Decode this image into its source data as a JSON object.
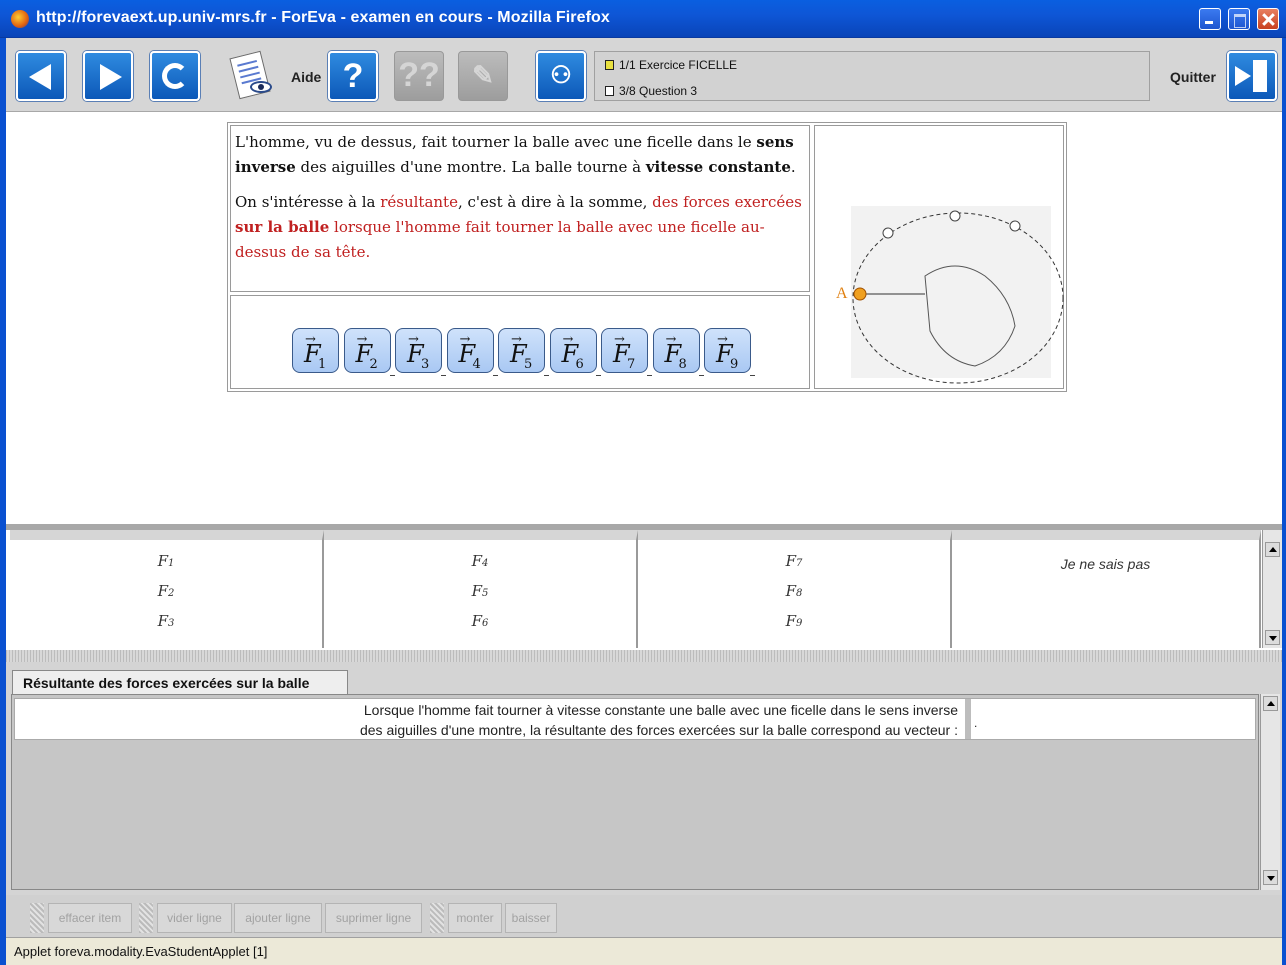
{
  "window": {
    "title": "http://forevaext.up.univ-mrs.fr - ForEva - examen en cours - Mozilla Firefox"
  },
  "toolbar": {
    "aide_label": "Aide",
    "quit_label": "Quitter",
    "exercise_line": "1/1  Exercice FICELLE",
    "question_line": "3/8  Question 3",
    "icons": [
      "back-arrow-icon",
      "forward-arrow-icon",
      "refresh-icon",
      "document-view-icon",
      "help-icon",
      "help-disabled-icon",
      "eraser-disabled-icon",
      "tree-icon",
      "exit-door-icon"
    ]
  },
  "question": {
    "para1_a": "L'homme, vu de dessus, fait tourner la balle avec une ficelle dans le ",
    "para1_b": "sens inverse",
    "para1_c": " des aiguilles d'une montre. La balle tourne à ",
    "para1_d": "vitesse constante",
    "para1_e": ".",
    "para2_a": "On s'intéresse à la ",
    "para2_b": "résultante",
    "para2_c": ", c'est à dire à la somme, ",
    "para2_d": "des forces exercées ",
    "para2_e": "sur la balle",
    "para2_f": " lorsque l'homme fait tourner la balle avec une ficelle au-dessus de sa tête.",
    "figure_label": "A",
    "red_color": "#c02020"
  },
  "force_buttons": [
    {
      "label": "F",
      "sub": "1"
    },
    {
      "label": "F",
      "sub": "2"
    },
    {
      "label": "F",
      "sub": "3"
    },
    {
      "label": "F",
      "sub": "4"
    },
    {
      "label": "F",
      "sub": "5"
    },
    {
      "label": "F",
      "sub": "6"
    },
    {
      "label": "F",
      "sub": "7"
    },
    {
      "label": "F",
      "sub": "8"
    },
    {
      "label": "F",
      "sub": "9"
    }
  ],
  "choices": {
    "col1": [
      "F",
      "F",
      "F"
    ],
    "col1_subs": [
      "1",
      "2",
      "3"
    ],
    "col2": [
      "F",
      "F",
      "F"
    ],
    "col2_subs": [
      "4",
      "5",
      "6"
    ],
    "col3": [
      "F",
      "F",
      "F"
    ],
    "col3_subs": [
      "7",
      "8",
      "9"
    ],
    "col4": "Je ne sais pas"
  },
  "lower": {
    "tab_label": "Résultante des forces exercées sur la balle",
    "sentence_line1": "Lorsque l'homme fait tourner à vitesse constante une balle avec une ficelle dans le sens inverse",
    "sentence_line2": "des aiguilles d'une montre, la résultante des forces exercées sur la balle correspond au vecteur :",
    "answer_value": "."
  },
  "buttons": {
    "effacer": "effacer item",
    "vider": "vider ligne",
    "ajouter": "ajouter ligne",
    "supprimer": "suprimer ligne",
    "monter": "monter",
    "baisser": "baisser"
  },
  "status": {
    "text": "Applet foreva.modality.EvaStudentApplet [1]"
  }
}
